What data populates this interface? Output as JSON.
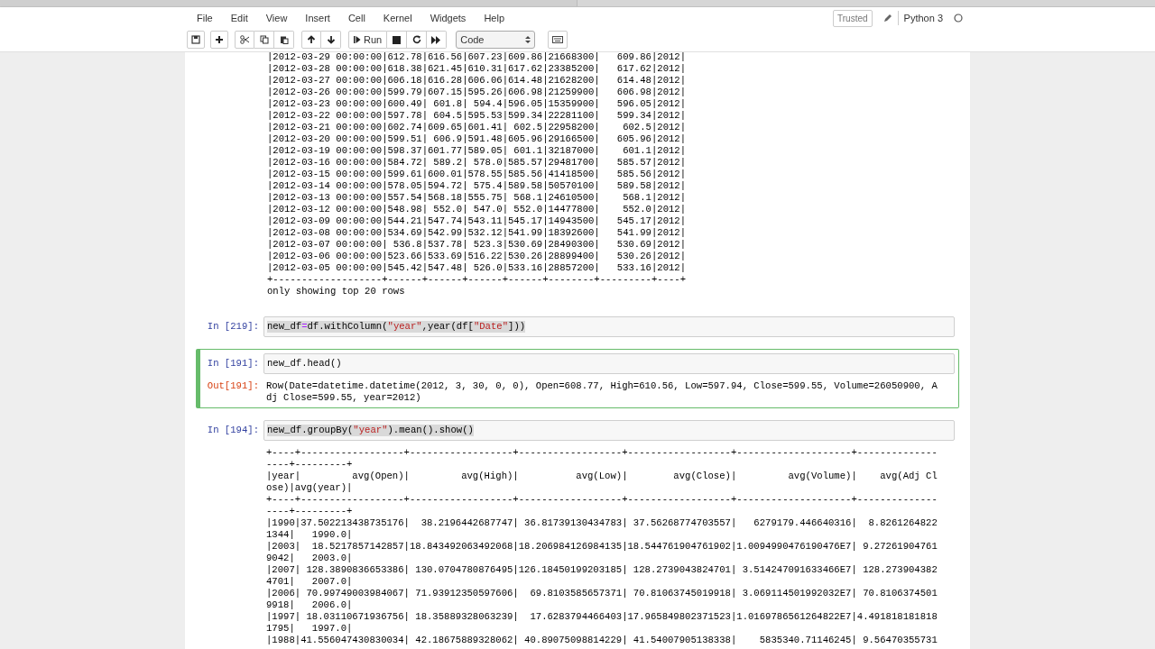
{
  "menu": [
    "File",
    "Edit",
    "View",
    "Insert",
    "Cell",
    "Kernel",
    "Widgets",
    "Help"
  ],
  "notebook_status": {
    "trusted": "Trusted",
    "kernel": "Python 3",
    "kernel_busy": false
  },
  "toolbar": {
    "run_label": "Run",
    "cell_type": "Code"
  },
  "cells": [
    {
      "output_lines": [
        "|2012-03-29 00:00:00|612.78|616.56|607.23|609.86|21668300|   609.86|2012|",
        "|2012-03-28 00:00:00|618.38|621.45|610.31|617.62|23385200|   617.62|2012|",
        "|2012-03-27 00:00:00|606.18|616.28|606.06|614.48|21628200|   614.48|2012|",
        "|2012-03-26 00:00:00|599.79|607.15|595.26|606.98|21259900|   606.98|2012|",
        "|2012-03-23 00:00:00|600.49| 601.8| 594.4|596.05|15359900|   596.05|2012|",
        "|2012-03-22 00:00:00|597.78| 604.5|595.53|599.34|22281100|   599.34|2012|",
        "|2012-03-21 00:00:00|602.74|609.65|601.41| 602.5|22958200|    602.5|2012|",
        "|2012-03-20 00:00:00|599.51| 606.9|591.48|605.96|29166500|   605.96|2012|",
        "|2012-03-19 00:00:00|598.37|601.77|589.05| 601.1|32187000|    601.1|2012|",
        "|2012-03-16 00:00:00|584.72| 589.2| 578.0|585.57|29481700|   585.57|2012|",
        "|2012-03-15 00:00:00|599.61|600.01|578.55|585.56|41418500|   585.56|2012|",
        "|2012-03-14 00:00:00|578.05|594.72| 575.4|589.58|50570100|   589.58|2012|",
        "|2012-03-13 00:00:00|557.54|568.18|555.75| 568.1|24610500|    568.1|2012|",
        "|2012-03-12 00:00:00|548.98| 552.0| 547.0| 552.0|14477800|    552.0|2012|",
        "|2012-03-09 00:00:00|544.21|547.74|543.11|545.17|14943500|   545.17|2012|",
        "|2012-03-08 00:00:00|534.69|542.99|532.12|541.99|18392600|   541.99|2012|",
        "|2012-03-07 00:00:00| 536.8|537.78| 523.3|530.69|28490300|   530.69|2012|",
        "|2012-03-06 00:00:00|523.66|533.69|516.22|530.26|28899400|   530.26|2012|",
        "|2012-03-05 00:00:00|545.42|547.48| 526.0|533.16|28857200|   533.16|2012|",
        "+-------------------+------+------+------+------+--------+---------+----+",
        "only showing top 20 rows"
      ]
    },
    {
      "selected": false,
      "prompt": "In [219]:",
      "highlighted": true,
      "code": [
        {
          "kind": "plain",
          "text": "new_df"
        },
        {
          "kind": "operator",
          "text": "="
        },
        {
          "kind": "plain",
          "text": "df.withColumn("
        },
        {
          "kind": "string",
          "text": "\"year\""
        },
        {
          "kind": "plain",
          "text": ",year(df["
        },
        {
          "kind": "string",
          "text": "\"Date\""
        },
        {
          "kind": "plain",
          "text": "]))"
        }
      ]
    },
    {
      "selected": true,
      "prompt": "In [191]:",
      "highlighted": false,
      "code": [
        {
          "kind": "plain",
          "text": "new_df.head()"
        }
      ],
      "out_prompt": "Out[191]:",
      "output_lines": [
        "Row(Date=datetime.datetime(2012, 3, 30, 0, 0), Open=608.77, High=610.56, Low=597.94, Close=599.55, Volume=26050900, A",
        "dj Close=599.55, year=2012)"
      ]
    },
    {
      "selected": false,
      "prompt": "In [194]:",
      "highlighted": true,
      "code": [
        {
          "kind": "plain",
          "text": "new_df.groupBy("
        },
        {
          "kind": "string",
          "text": "\"year\""
        },
        {
          "kind": "plain",
          "text": ").mean().show()"
        }
      ],
      "output_lines": [
        "+----+------------------+------------------+------------------+------------------+--------------------+--------------",
        "----+---------+",
        "|year|         avg(Open)|         avg(High)|          avg(Low)|        avg(Close)|         avg(Volume)|    avg(Adj Cl",
        "ose)|avg(year)|",
        "+----+------------------+------------------+------------------+------------------+--------------------+--------------",
        "----+---------+",
        "|1990|37.502213438735176|  38.2196442687747| 36.81739130434783| 37.56268774703557|   6279179.446640316|  8.8261264822",
        "1344|   1990.0|",
        "|2003|  18.5217857142857|18.843492063492068|18.206984126984135|18.544761904761902|1.0094990476190476E7| 9.27261904761",
        "9042|   2003.0|",
        "|2007| 128.3890836653386| 130.0704780876495|126.18450199203185| 128.2739043824701| 3.514247091633466E7| 128.273904382",
        "4701|   2007.0|",
        "|2006| 70.99749003984067| 71.93912350597606|  69.8103585657371| 70.81063745019918| 3.069114501992032E7| 70.8106374501",
        "9918|   2006.0|",
        "|1997| 18.03110671936756| 18.35889328063239|  17.6283794466403|17.965849802371523|1.0169786561264822E7|4.491818181818",
        "1795|   1997.0|",
        "|1988|41.556047430830034| 42.18675889328062| 40.89075098814229| 41.54007905138338|    5835340.71146245| 9.56470355731"
      ]
    }
  ]
}
